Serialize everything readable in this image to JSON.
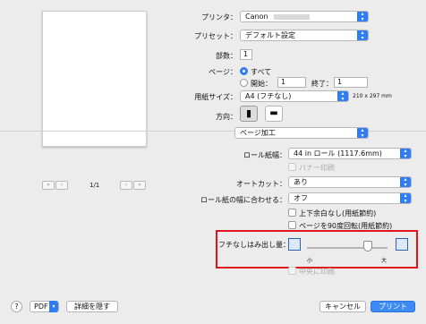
{
  "preview": {
    "page_count": "1/1",
    "first": "«",
    "prev": "‹",
    "next": "›",
    "last": "»"
  },
  "printer": {
    "label": "プリンタ：",
    "value": "Canon"
  },
  "preset": {
    "label": "プリセット：",
    "value": "デフォルト設定"
  },
  "copies": {
    "label": "部数：",
    "value": "1"
  },
  "pages": {
    "label": "ページ：",
    "all": "すべて",
    "start_label": "開始：",
    "start": "1",
    "end_label": "終了：",
    "end": "1"
  },
  "paper_size": {
    "label": "用紙サイズ：",
    "value": "A4 (フチなし)",
    "dimensions": "210 x 297 mm"
  },
  "orientation": {
    "label": "方向："
  },
  "section": {
    "value": "ページ加工"
  },
  "roll_width": {
    "label": "ロール紙幅：",
    "value": "44 in ロール (1117.6mm)"
  },
  "banner": {
    "label": "バナー印刷"
  },
  "autocut": {
    "label": "オートカット：",
    "value": "あり"
  },
  "fit_roll": {
    "label": "ロール紙の幅に合わせる：",
    "value": "オフ"
  },
  "no_margin": {
    "label": "上下余白なし(用紙節約)"
  },
  "rotate90": {
    "label": "ページを90度回転(用紙節約)"
  },
  "borderless": {
    "label": "フチなしはみ出し量：",
    "min_label": "小",
    "max_label": "大",
    "level": 0.75
  },
  "center": {
    "label": "中央に印刷"
  },
  "bottom": {
    "help": "?",
    "pdf": "PDF",
    "hide_details": "詳細を隠す",
    "cancel": "キャンセル",
    "print": "プリント"
  }
}
